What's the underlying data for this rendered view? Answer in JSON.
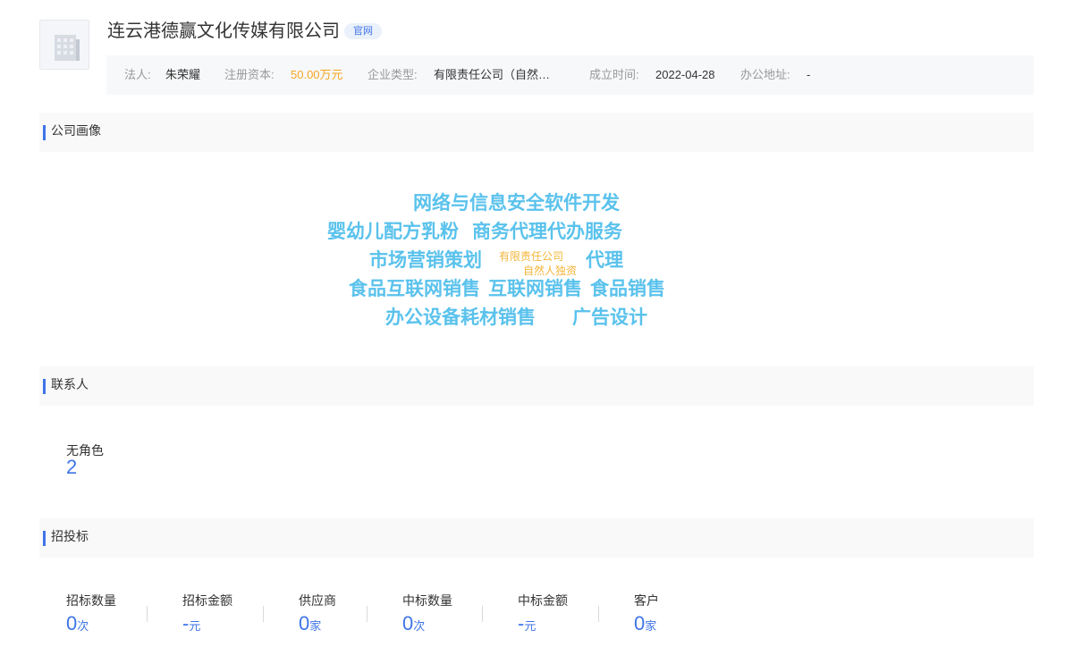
{
  "company": {
    "name": "连云港德赢文化传媒有限公司",
    "badge": "官网"
  },
  "info": {
    "legal_person_label": "法人:",
    "legal_person": "朱荣耀",
    "capital_label": "注册资本:",
    "capital": "50.00万元",
    "type_label": "企业类型:",
    "type": "有限责任公司（自然…",
    "founded_label": "成立时间:",
    "founded": "2022-04-28",
    "address_label": "办公地址:",
    "address": "-"
  },
  "sections": {
    "portrait": "公司画像",
    "contacts": "联系人",
    "bidding": "招投标"
  },
  "word_cloud": [
    "网络与信息安全软件开发",
    "婴幼儿配方乳粉",
    "商务代理代办服务",
    "市场营销策划",
    "有限责任公司",
    "自然人独资",
    "代理",
    "食品互联网销售",
    "互联网销售",
    "食品销售",
    "办公设备耗材销售",
    "广告设计"
  ],
  "contacts": {
    "role_label": "无角色",
    "role_count": "2"
  },
  "bidding_stats": [
    {
      "label": "招标数量",
      "value": "0",
      "unit": "次"
    },
    {
      "label": "招标金额",
      "value": "-",
      "unit": "元"
    },
    {
      "label": "供应商",
      "value": "0",
      "unit": "家"
    },
    {
      "label": "中标数量",
      "value": "0",
      "unit": "次"
    },
    {
      "label": "中标金额",
      "value": "-",
      "unit": "元"
    },
    {
      "label": "客户",
      "value": "0",
      "unit": "家"
    }
  ],
  "colors": {
    "accent": "#3e74e8",
    "word_cloud_primary": "#5ac2ec",
    "word_cloud_secondary": "#f4b63a",
    "capital": "#f5a623"
  }
}
